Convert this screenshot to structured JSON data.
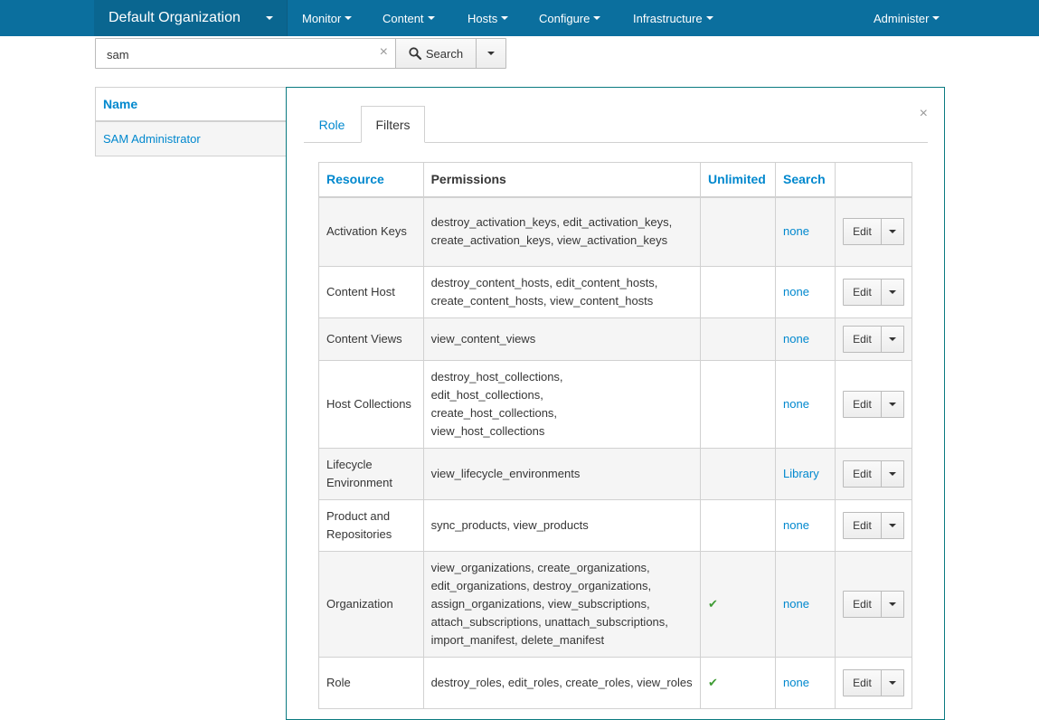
{
  "navbar": {
    "org": "Default Organization",
    "menus": [
      {
        "label": "Monitor"
      },
      {
        "label": "Content"
      },
      {
        "label": "Hosts"
      },
      {
        "label": "Configure"
      },
      {
        "label": "Infrastructure"
      },
      {
        "label": "Administer"
      }
    ]
  },
  "search": {
    "value": "sam",
    "clear_glyph": "×",
    "button_label": "Search",
    "icon": "search-icon"
  },
  "list": {
    "header": "Name",
    "rows": [
      "SAM Administrator"
    ]
  },
  "panel": {
    "close_glyph": "×",
    "tabs": [
      "Role",
      "Filters"
    ],
    "active_tab": "Filters"
  },
  "filters": {
    "headers": {
      "resource": "Resource",
      "permissions": "Permissions",
      "unlimited": "Unlimited",
      "search": "Search"
    },
    "edit_label": "Edit",
    "rows": [
      {
        "resource": "Activation Keys",
        "permissions": "destroy_activation_keys, edit_activation_keys, create_activation_keys, view_activation_keys",
        "unlimited": false,
        "search": "none"
      },
      {
        "resource": "Content Host",
        "permissions": "destroy_content_hosts, edit_content_hosts, create_content_hosts, view_content_hosts",
        "unlimited": false,
        "search": "none"
      },
      {
        "resource": "Content Views",
        "permissions": "view_content_views",
        "unlimited": false,
        "search": "none"
      },
      {
        "resource": "Host Collections",
        "permissions": "destroy_host_collections, edit_host_collections, create_host_collections, view_host_collections",
        "unlimited": false,
        "search": "none"
      },
      {
        "resource": "Lifecycle Environment",
        "permissions": "view_lifecycle_environments",
        "unlimited": false,
        "search": "Library"
      },
      {
        "resource": "Product and Repositories",
        "permissions": "sync_products, view_products",
        "unlimited": false,
        "search": "none"
      },
      {
        "resource": "Organization",
        "permissions": "view_organizations, create_organizations, edit_organizations, destroy_organizations, assign_organizations, view_subscriptions, attach_subscriptions, unattach_subscriptions, import_manifest, delete_manifest",
        "unlimited": true,
        "search": "none"
      },
      {
        "resource": "Role",
        "permissions": "destroy_roles, edit_roles, create_roles, view_roles",
        "unlimited": true,
        "search": "none"
      }
    ]
  },
  "colors": {
    "navbar": "#0b6f9e",
    "link": "#0088ce",
    "check": "#3f9c35",
    "panel_border": "#0a7a80"
  }
}
